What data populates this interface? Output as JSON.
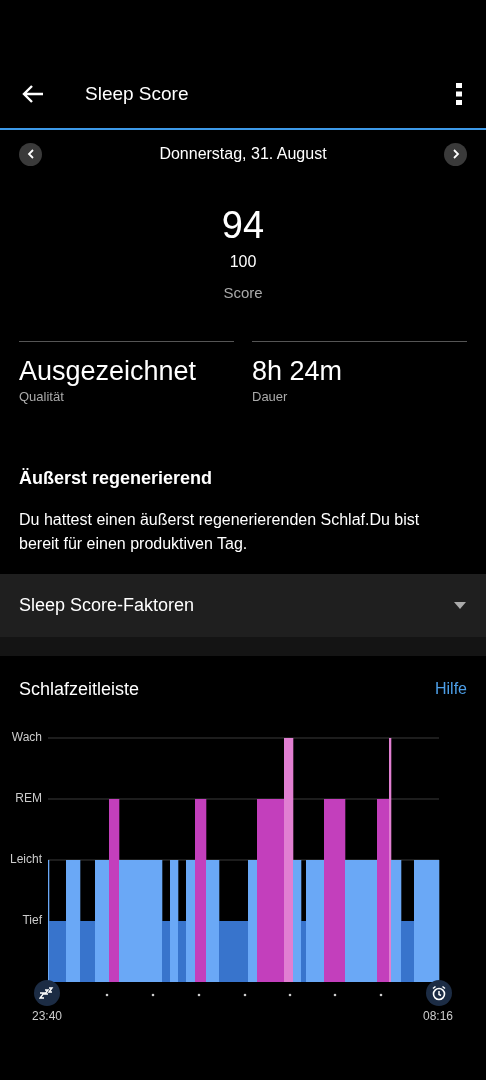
{
  "header": {
    "title": "Sleep Score"
  },
  "date_nav": {
    "date": "Donnerstag, 31. August"
  },
  "score": {
    "value": "94",
    "max": "100",
    "label": "Score"
  },
  "stats": [
    {
      "value": "Ausgezeichnet",
      "label": "Qualität"
    },
    {
      "value": "8h 24m",
      "label": "Dauer"
    }
  ],
  "summary": {
    "title": "Äußerst regenerierend",
    "text": "Du hattest einen äußerst regenerierenden Schlaf.Du bist bereit für einen produktiven Tag."
  },
  "factors": {
    "title": "Sleep Score-Faktoren",
    "expanded": false
  },
  "timeline": {
    "title": "Schlafzeitleiste",
    "help": "Hilfe",
    "stages": [
      "Wach",
      "REM",
      "Leicht",
      "Tief"
    ],
    "start_time": "23:40",
    "end_time": "08:16"
  }
}
